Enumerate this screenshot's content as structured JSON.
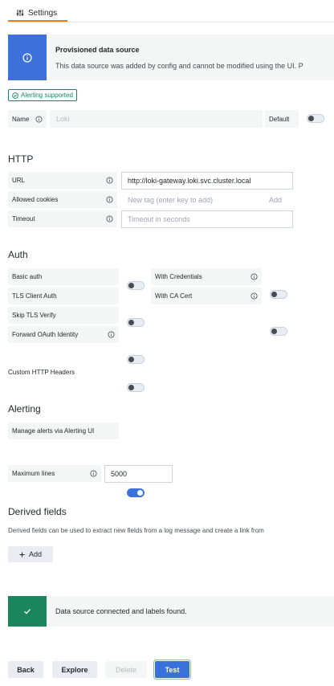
{
  "tabs": [
    {
      "label": "Settings"
    }
  ],
  "provisioned": {
    "title": "Provisioned data source",
    "text": "This data source was added by config and cannot be modified using the UI. P"
  },
  "badge": {
    "label": "Alerting supported"
  },
  "name_row": {
    "label": "Name",
    "placeholder": "Loki",
    "default_label": "Default"
  },
  "http": {
    "heading": "HTTP",
    "url": {
      "label": "URL",
      "value": "http://loki-gateway.loki.svc.cluster.local"
    },
    "cookies": {
      "label": "Allowed cookies",
      "placeholder": "New tag (enter key to add)",
      "add_label": "Add"
    },
    "timeout": {
      "label": "Timeout",
      "placeholder": "Timeout in seconds"
    }
  },
  "auth": {
    "heading": "Auth",
    "basic": {
      "label": "Basic auth",
      "on": false
    },
    "credentials": {
      "label": "With Credentials",
      "on": false
    },
    "tls_client": {
      "label": "TLS Client Auth",
      "on": false
    },
    "ca_cert": {
      "label": "With CA Cert",
      "on": false
    },
    "skip_tls": {
      "label": "Skip TLS Verify",
      "on": false
    },
    "oauth": {
      "label": "Forward OAuth Identity",
      "on": false
    }
  },
  "custom_headers": {
    "label": "Custom HTTP Headers"
  },
  "alerting": {
    "heading": "Alerting",
    "manage": {
      "label": "Manage alerts via Alerting UI",
      "on": true
    }
  },
  "max_lines": {
    "label": "Maximum lines",
    "value": "5000"
  },
  "derived": {
    "heading": "Derived fields",
    "description": "Derived fields can be used to extract new fields from a log message and create a link from",
    "add_label": "Add"
  },
  "success": {
    "text": "Data source connected and labels found."
  },
  "buttons": {
    "back": "Back",
    "explore": "Explore",
    "delete": "Delete",
    "test": "Test"
  },
  "colors": {
    "accent": "#3871dc",
    "tab_underline": "#eb7b18",
    "success": "#1b855e",
    "info": "#3d71d9"
  }
}
